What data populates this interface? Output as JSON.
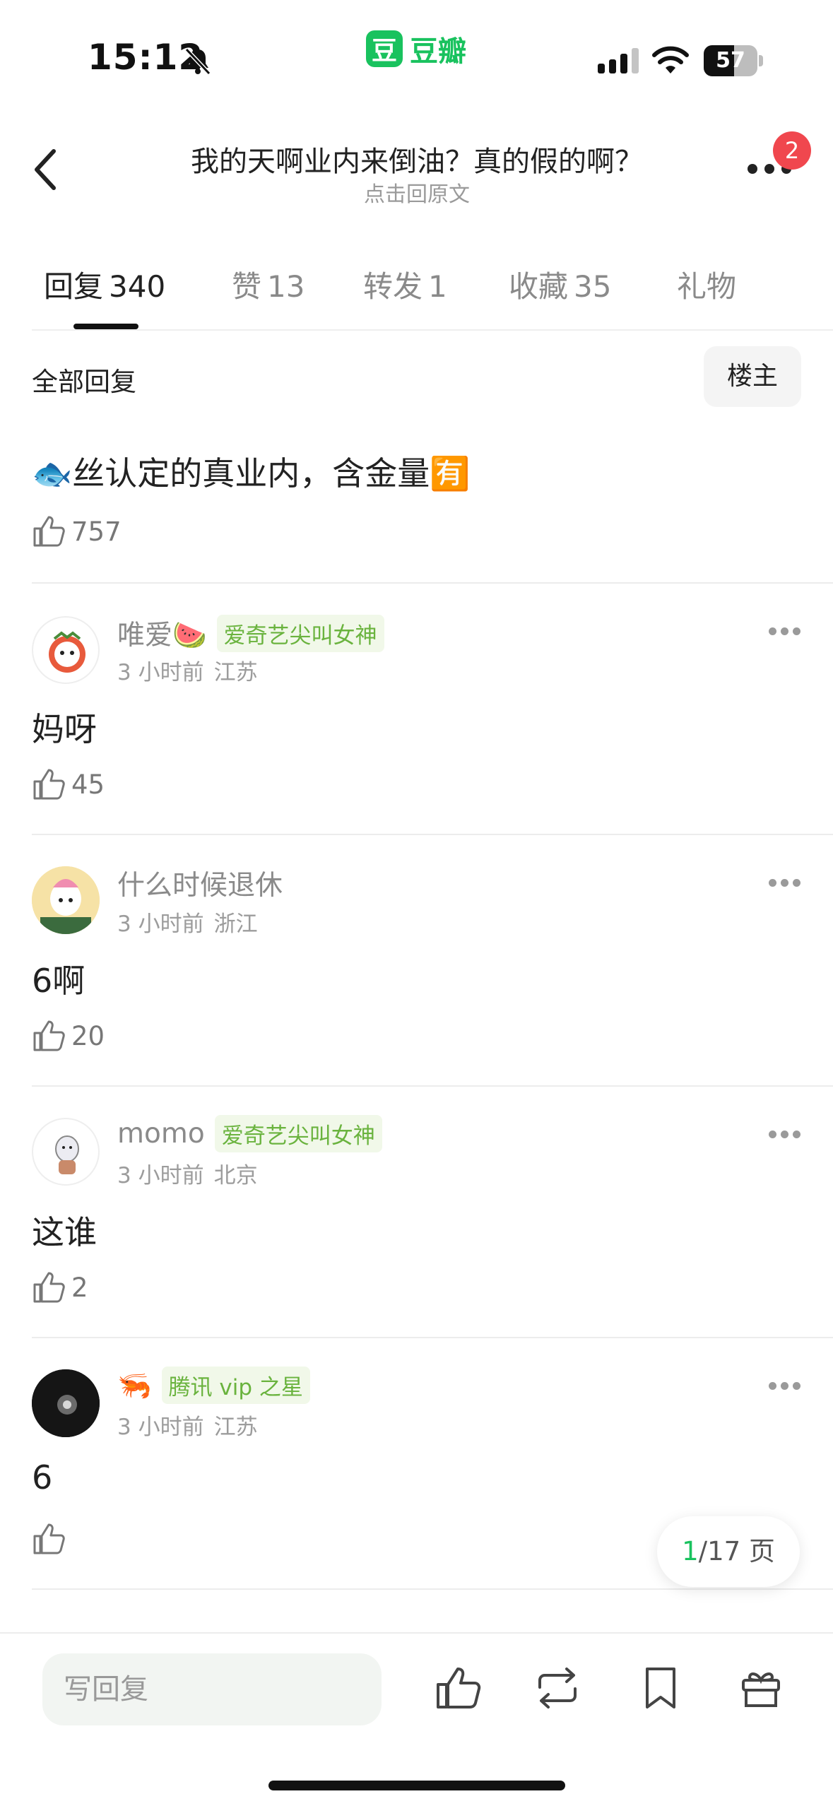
{
  "status_bar": {
    "time": "15:12",
    "battery": "57",
    "battery_level": 0.57,
    "app_name": "豆瓣",
    "app_logo_char": "豆"
  },
  "header": {
    "title": "我的天啊业内来倒油？真的假的啊？",
    "subtitle": "点击回原文",
    "notification_count": "2"
  },
  "tabs": [
    {
      "label": "回复",
      "count": "340"
    },
    {
      "label": "赞",
      "count": "13"
    },
    {
      "label": "转发",
      "count": "1"
    },
    {
      "label": "收藏",
      "count": "35"
    },
    {
      "label": "礼物",
      "count": ""
    }
  ],
  "filter": {
    "label": "全部回复",
    "owner_button": "楼主"
  },
  "first_comment": {
    "content": "🐟丝认定的真业内，含金量🈶",
    "likes": "757"
  },
  "comments": [
    {
      "author": "唯爱🍉",
      "tag": "爱奇艺尖叫女神",
      "time": "3 小时前",
      "location": "江苏",
      "content": "妈呀",
      "likes": "45"
    },
    {
      "author": "什么时候退休",
      "tag": "",
      "time": "3 小时前",
      "location": "浙江",
      "content": "6啊",
      "likes": "20"
    },
    {
      "author": "momo",
      "tag": "爱奇艺尖叫女神",
      "time": "3 小时前",
      "location": "北京",
      "content": "这谁",
      "likes": "2"
    },
    {
      "author": "🦐",
      "tag": "腾讯 vip 之星",
      "time": "3 小时前",
      "location": "江苏",
      "content": "6",
      "likes": ""
    }
  ],
  "pagination": {
    "current": "1",
    "total_text": "/17 页"
  },
  "bottom_bar": {
    "reply_placeholder": "写回复"
  },
  "colors": {
    "brand_green": "#19c25e",
    "tag_green": "#6ab33e",
    "badge_red": "#f0474e"
  }
}
